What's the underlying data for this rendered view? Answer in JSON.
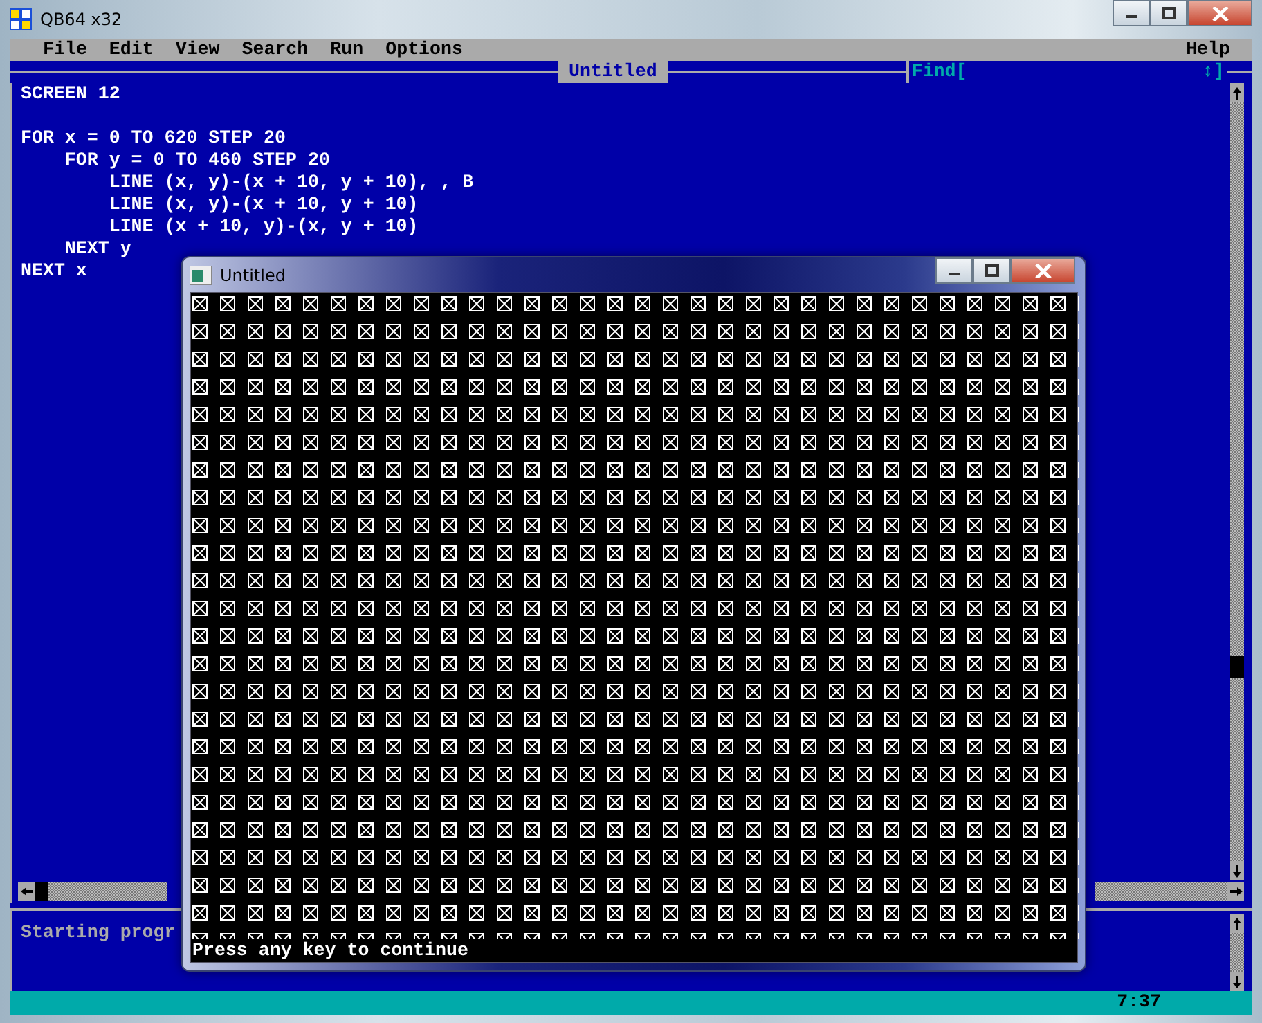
{
  "window": {
    "title": "QB64 x32"
  },
  "menu": [
    {
      "label": "File"
    },
    {
      "label": "Edit"
    },
    {
      "label": "View"
    },
    {
      "label": "Search"
    },
    {
      "label": "Run"
    },
    {
      "label": "Options"
    }
  ],
  "menu_right": [
    {
      "label": "Help"
    }
  ],
  "editor": {
    "title": "Untitled",
    "find": {
      "label": "Find[",
      "end": "↕]"
    },
    "code_blocks": [
      [
        "SCREEN 12"
      ],
      [
        "FOR x = 0 TO 620 STEP 20",
        "    FOR y = 0 TO 460 STEP 20",
        "        LINE (x, y)-(x + 10, y + 10), , B",
        "        LINE (x, y)-(x + 10, y + 10)",
        "        LINE (x + 10, y)-(x, y + 10)",
        "    NEXT y",
        "NEXT x"
      ]
    ]
  },
  "immediate": {
    "text": "Starting progr"
  },
  "status_bar": {
    "position": "7:37"
  },
  "output_window": {
    "title": "Untitled",
    "message": "Press any key to continue"
  }
}
